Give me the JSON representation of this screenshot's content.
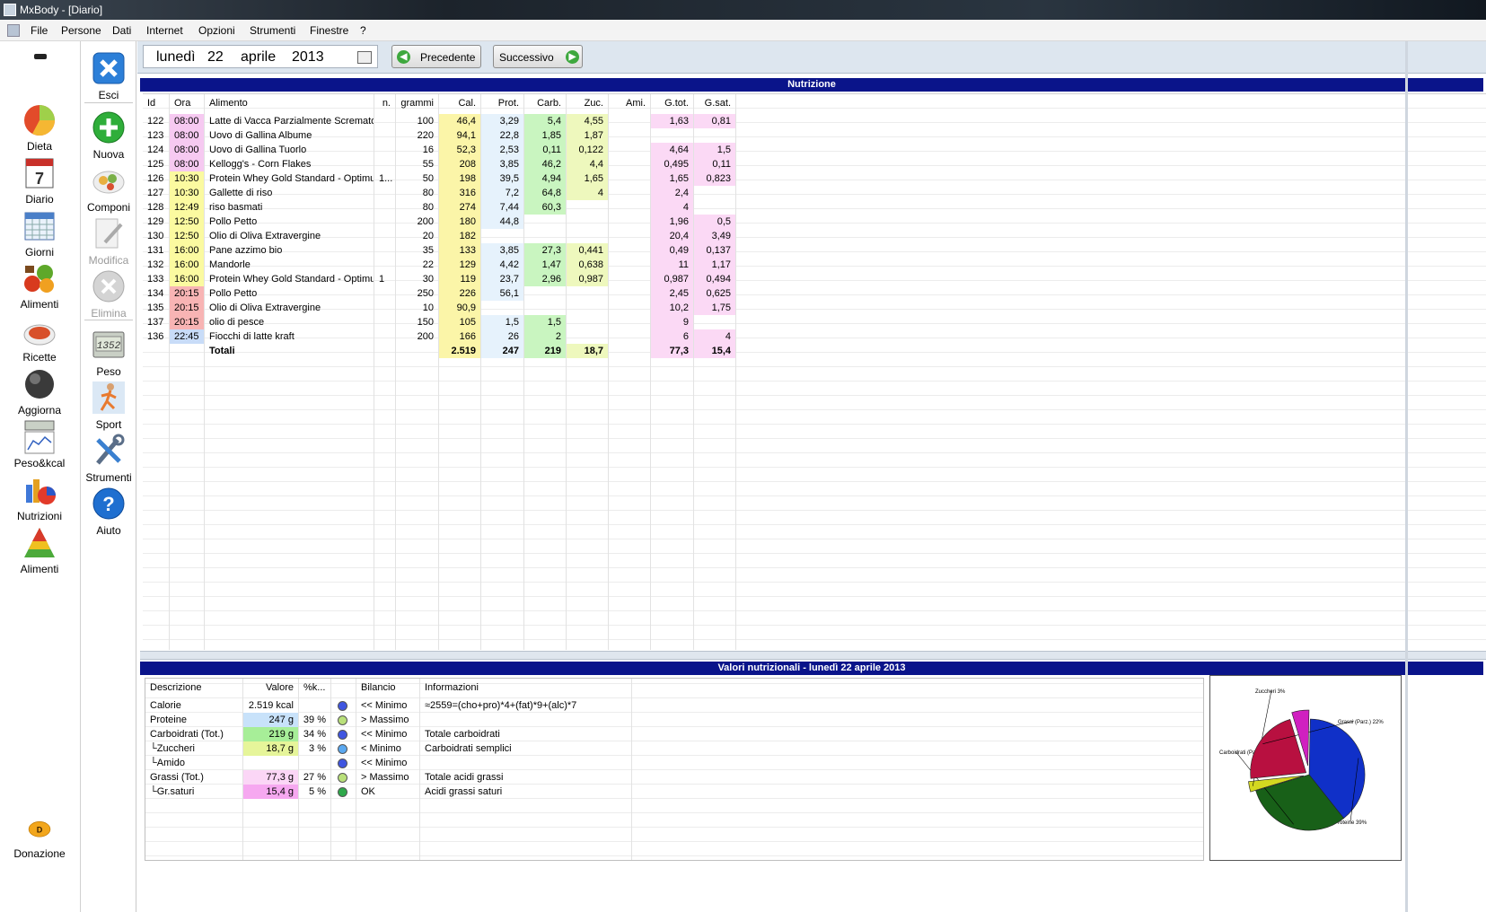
{
  "window": {
    "title": "MxBody - [Diario]"
  },
  "menu": [
    "File",
    "Persone",
    "Dati",
    "Internet",
    "Opzioni",
    "Strumenti",
    "Finestre",
    "?"
  ],
  "sidebar": {
    "items": [
      {
        "label": "Dieta",
        "icon": "pie-chart-icon"
      },
      {
        "label": "Diario",
        "icon": "calendar-icon"
      },
      {
        "label": "Giorni",
        "icon": "calendar-grid-icon"
      },
      {
        "label": "Alimenti",
        "icon": "vegetables-icon"
      },
      {
        "label": "Ricette",
        "icon": "recipe-icon"
      },
      {
        "label": "Aggiorna",
        "icon": "globe-icon"
      },
      {
        "label": "Peso&kcal",
        "icon": "scale-chart-icon"
      },
      {
        "label": "Nutrizioni",
        "icon": "bar-pie-icon"
      },
      {
        "label": "Alimenti",
        "icon": "food-pyramid-icon"
      }
    ],
    "donate": {
      "label": "Donazione",
      "badge": "D"
    }
  },
  "toolbar": {
    "items": [
      {
        "label": "Esci",
        "icon": "exit-icon",
        "enabled": true
      },
      {
        "label": "Nuova",
        "icon": "add-icon",
        "enabled": true
      },
      {
        "label": "Componi",
        "icon": "compose-icon",
        "enabled": true
      },
      {
        "label": "Modifica",
        "icon": "edit-icon",
        "enabled": false
      },
      {
        "label": "Elimina",
        "icon": "delete-icon",
        "enabled": false
      },
      {
        "label": "Peso",
        "icon": "scale-icon",
        "enabled": true
      },
      {
        "label": "Sport",
        "icon": "runner-icon",
        "enabled": true
      },
      {
        "label": "Strumenti",
        "icon": "tools-icon",
        "enabled": true
      },
      {
        "label": "Aiuto",
        "icon": "help-icon",
        "enabled": true
      }
    ],
    "scale_display": "1352"
  },
  "datebar": {
    "day_name": "lunedì",
    "day": "22",
    "month": "aprile",
    "year": "2013",
    "prev_label": "Precedente",
    "next_label": "Successivo"
  },
  "nutrition": {
    "title": "Nutrizione",
    "columns": [
      "Id",
      "Ora",
      "Alimento",
      "n.",
      "grammi",
      "Cal.",
      "Prot.",
      "Carb.",
      "Zuc.",
      "Ami.",
      "G.tot.",
      "G.sat."
    ],
    "rows": [
      {
        "id": "122",
        "time": "08:00",
        "food": "Latte di Vacca Parzialmente Scremato",
        "n": "",
        "g": "100",
        "cal": "46,4",
        "prot": "3,29",
        "carb": "5,4",
        "zuc": "4,55",
        "ami": "",
        "gtot": "1,63",
        "gsat": "0,81"
      },
      {
        "id": "123",
        "time": "08:00",
        "food": "Uovo di Gallina Albume",
        "n": "",
        "g": "220",
        "cal": "94,1",
        "prot": "22,8",
        "carb": "1,85",
        "zuc": "1,87",
        "ami": "",
        "gtot": "",
        "gsat": ""
      },
      {
        "id": "124",
        "time": "08:00",
        "food": "Uovo di Gallina Tuorlo",
        "n": "",
        "g": "16",
        "cal": "52,3",
        "prot": "2,53",
        "carb": "0,11",
        "zuc": "0,122",
        "ami": "",
        "gtot": "4,64",
        "gsat": "1,5"
      },
      {
        "id": "125",
        "time": "08:00",
        "food": "Kellogg's - Corn Flakes",
        "n": "",
        "g": "55",
        "cal": "208",
        "prot": "3,85",
        "carb": "46,2",
        "zuc": "4,4",
        "ami": "",
        "gtot": "0,495",
        "gsat": "0,11"
      },
      {
        "id": "126",
        "time": "10:30",
        "food": "Protein Whey Gold Standard - Optimu...",
        "n": "1...",
        "g": "50",
        "cal": "198",
        "prot": "39,5",
        "carb": "4,94",
        "zuc": "1,65",
        "ami": "",
        "gtot": "1,65",
        "gsat": "0,823"
      },
      {
        "id": "127",
        "time": "10:30",
        "food": "Gallette di riso",
        "n": "",
        "g": "80",
        "cal": "316",
        "prot": "7,2",
        "carb": "64,8",
        "zuc": "4",
        "ami": "",
        "gtot": "2,4",
        "gsat": ""
      },
      {
        "id": "128",
        "time": "12:49",
        "food": "riso basmati",
        "n": "",
        "g": "80",
        "cal": "274",
        "prot": "7,44",
        "carb": "60,3",
        "zuc": "",
        "ami": "",
        "gtot": "4",
        "gsat": ""
      },
      {
        "id": "129",
        "time": "12:50",
        "food": "Pollo Petto",
        "n": "",
        "g": "200",
        "cal": "180",
        "prot": "44,8",
        "carb": "",
        "zuc": "",
        "ami": "",
        "gtot": "1,96",
        "gsat": "0,5"
      },
      {
        "id": "130",
        "time": "12:50",
        "food": "Olio di Oliva Extravergine",
        "n": "",
        "g": "20",
        "cal": "182",
        "prot": "",
        "carb": "",
        "zuc": "",
        "ami": "",
        "gtot": "20,4",
        "gsat": "3,49"
      },
      {
        "id": "131",
        "time": "16:00",
        "food": "Pane azzimo bio",
        "n": "",
        "g": "35",
        "cal": "133",
        "prot": "3,85",
        "carb": "27,3",
        "zuc": "0,441",
        "ami": "",
        "gtot": "0,49",
        "gsat": "0,137"
      },
      {
        "id": "132",
        "time": "16:00",
        "food": "Mandorle",
        "n": "",
        "g": "22",
        "cal": "129",
        "prot": "4,42",
        "carb": "1,47",
        "zuc": "0,638",
        "ami": "",
        "gtot": "11",
        "gsat": "1,17"
      },
      {
        "id": "133",
        "time": "16:00",
        "food": "Protein Whey Gold Standard - Optimu...",
        "n": "1",
        "g": "30",
        "cal": "119",
        "prot": "23,7",
        "carb": "2,96",
        "zuc": "0,987",
        "ami": "",
        "gtot": "0,987",
        "gsat": "0,494"
      },
      {
        "id": "134",
        "time": "20:15",
        "food": "Pollo Petto",
        "n": "",
        "g": "250",
        "cal": "226",
        "prot": "56,1",
        "carb": "",
        "zuc": "",
        "ami": "",
        "gtot": "2,45",
        "gsat": "0,625"
      },
      {
        "id": "135",
        "time": "20:15",
        "food": "Olio di Oliva Extravergine",
        "n": "",
        "g": "10",
        "cal": "90,9",
        "prot": "",
        "carb": "",
        "zuc": "",
        "ami": "",
        "gtot": "10,2",
        "gsat": "1,75"
      },
      {
        "id": "137",
        "time": "20:15",
        "food": "olio di pesce",
        "n": "",
        "g": "150",
        "cal": "105",
        "prot": "1,5",
        "carb": "1,5",
        "zuc": "",
        "ami": "",
        "gtot": "9",
        "gsat": ""
      },
      {
        "id": "136",
        "time": "22:45",
        "food": "Fiocchi di latte kraft",
        "n": "",
        "g": "200",
        "cal": "166",
        "prot": "26",
        "carb": "2",
        "zuc": "",
        "ami": "",
        "gtot": "6",
        "gsat": "4"
      }
    ],
    "totals": {
      "label": "Totali",
      "cal": "2.519",
      "prot": "247",
      "carb": "219",
      "zuc": "18,7",
      "ami": "",
      "gtot": "77,3",
      "gsat": "15,4"
    },
    "colors": {
      "time_morning": "#f6c9f1",
      "time_mid": "#fbfaa0",
      "time_late": "#f8b4b4",
      "time_night": "#c8dcf8",
      "cal": "#fbf5a8",
      "prot": "#e6f2fc",
      "carb": "#c9f5c0",
      "zuc": "#eef8bd",
      "fat": "#fbd9f5"
    }
  },
  "values": {
    "title": "Valori nutrizionali - lunedì 22 aprile 2013",
    "columns": [
      "Descrizione",
      "Valore",
      "%k...",
      "",
      "Bilancio",
      "Informazioni"
    ],
    "rows": [
      {
        "desc": "Calorie",
        "val": "2.519 kcal",
        "pct": "",
        "dot": "#3f55e0",
        "bal": "<< Minimo",
        "info": "≈2559=(cho+pro)*4+(fat)*9+(alc)*7",
        "valbg": "#ffffff"
      },
      {
        "desc": "Proteine",
        "val": "247 g",
        "pct": "39 %",
        "dot": "#b9e07a",
        "bal": "> Massimo",
        "info": "",
        "valbg": "#c8e2fa"
      },
      {
        "desc": "Carboidrati (Tot.)",
        "val": "219 g",
        "pct": "34 %",
        "dot": "#3f55e0",
        "bal": "<< Minimo",
        "info": "Totale carboidrati",
        "valbg": "#a7ee98"
      },
      {
        "desc": "└Zuccheri",
        "val": "18,7 g",
        "pct": "3 %",
        "dot": "#5aa8f0",
        "bal": "< Minimo",
        "info": "Carboidrati semplici",
        "valbg": "#e6f59a"
      },
      {
        "desc": "└Amido",
        "val": "",
        "pct": "",
        "dot": "#3f55e0",
        "bal": "<< Minimo",
        "info": "",
        "valbg": "#ffffff"
      },
      {
        "desc": "Grassi (Tot.)",
        "val": "77,3 g",
        "pct": "27 %",
        "dot": "#b9e07a",
        "bal": "> Massimo",
        "info": "Totale acidi grassi",
        "valbg": "#fbd6f6"
      },
      {
        "desc": "└Gr.saturi",
        "val": "15,4 g",
        "pct": "5 %",
        "dot": "#2ea84a",
        "bal": "OK",
        "info": "Acidi grassi saturi",
        "valbg": "#f6a8f0"
      }
    ]
  },
  "pie": {
    "slices": [
      {
        "label": "Proteine 39%",
        "value": 39,
        "color": "#1030c8"
      },
      {
        "label": "Carboidrati (Parz.) 31%",
        "value": 31,
        "color": "#186018"
      },
      {
        "label": "Zuccheri 3%",
        "value": 3,
        "color": "#d4d820"
      },
      {
        "label": "Grassi (Parz.) 22%",
        "value": 22,
        "color": "#b81040"
      },
      {
        "label": "",
        "value": 5,
        "color": "#d020c0"
      }
    ]
  }
}
